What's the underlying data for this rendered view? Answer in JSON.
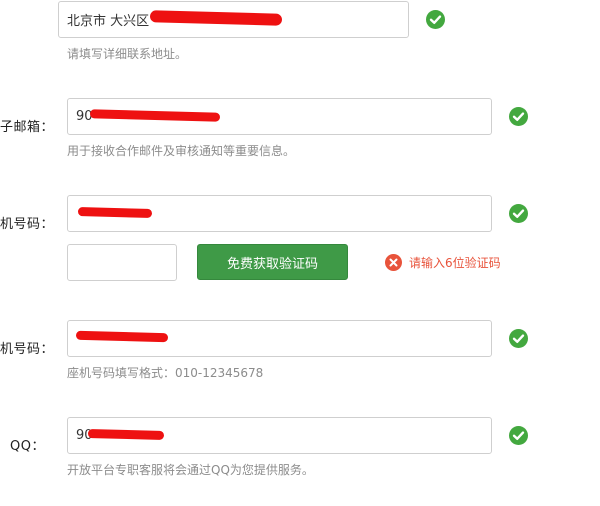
{
  "address": {
    "region_prefix": "北京市 大兴区",
    "hint": "请填写详细联系地址。",
    "status_icon": "check-circle-icon"
  },
  "email": {
    "label": "子邮箱：",
    "value_visible": "90",
    "hint": "用于接收合作邮件及审核通知等重要信息。",
    "status_icon": "check-circle-icon"
  },
  "mobile": {
    "label": "机号码：",
    "status_icon": "check-circle-icon"
  },
  "verify": {
    "code_placeholder": "",
    "button_label": "免费获取验证码",
    "error_text": "请输入6位验证码",
    "error_icon": "close-circle-icon"
  },
  "landline": {
    "label": "机号码：",
    "hint": "座机号码填写格式：010-12345678",
    "status_icon": "check-circle-icon"
  },
  "qq": {
    "label": "QQ：",
    "value_visible": "90",
    "hint": "开放平台专职客服将会通过QQ为您提供服务。",
    "status_icon": "check-circle-icon"
  },
  "colors": {
    "success": "#43a83f",
    "error": "#e8533b",
    "button": "#3f9a47",
    "redaction": "#ee1111"
  }
}
